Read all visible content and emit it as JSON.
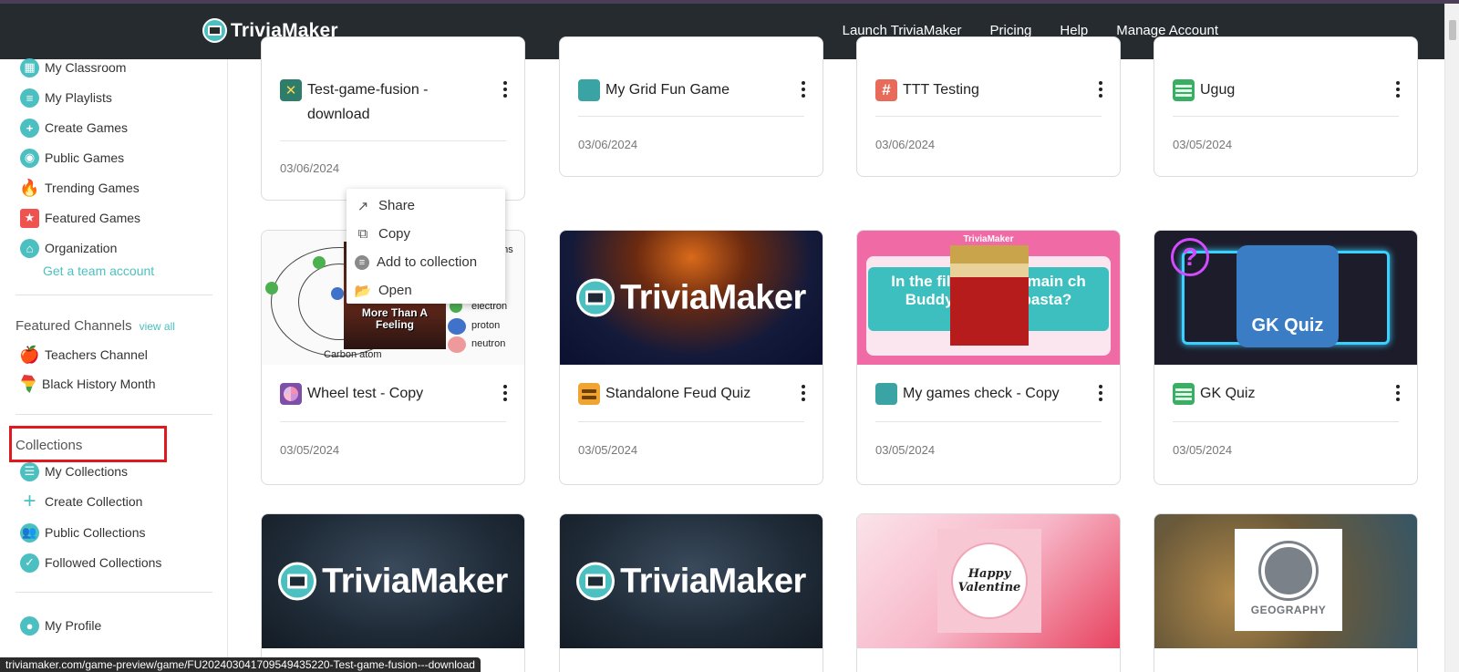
{
  "brand": {
    "name": "TriviaMaker"
  },
  "nav": {
    "links": [
      "Launch TriviaMaker",
      "Pricing",
      "Help",
      "Manage Account"
    ]
  },
  "sidebar": {
    "items": [
      {
        "label": "My Classroom",
        "icon": "classroom-icon"
      },
      {
        "label": "My Playlists",
        "icon": "playlist-icon"
      },
      {
        "label": "Create Games",
        "icon": "plus-icon"
      },
      {
        "label": "Public Games",
        "icon": "globe-icon"
      },
      {
        "label": "Trending Games",
        "icon": "flame-icon"
      },
      {
        "label": "Featured Games",
        "icon": "star-icon"
      },
      {
        "label": "Organization",
        "icon": "building-icon"
      }
    ],
    "team_link": "Get a team account",
    "featured_heading": "Featured Channels",
    "view_all": "view all",
    "channels": [
      {
        "label": "Teachers Channel",
        "icon": "apple-icon"
      },
      {
        "label": "Black History Month",
        "icon": "africa-icon"
      }
    ],
    "collections_heading": "Collections",
    "collections": [
      {
        "label": "My Collections",
        "icon": "list-icon"
      },
      {
        "label": "Create Collection",
        "icon": "plus-icon"
      },
      {
        "label": "Public Collections",
        "icon": "people-icon"
      },
      {
        "label": "Followed Collections",
        "icon": "check-icon"
      }
    ],
    "profile": {
      "label": "My Profile",
      "icon": "user-icon"
    }
  },
  "cards": {
    "row1": [
      {
        "title": "Test-game-fusion - download",
        "date": "03/06/2024",
        "icon": "fusion-icon"
      },
      {
        "title": "My Grid Fun Game",
        "date": "03/06/2024",
        "icon": "grid-icon"
      },
      {
        "title": "TTT Testing",
        "date": "03/06/2024",
        "icon": "hash-icon"
      },
      {
        "title": "Ugug",
        "date": "03/05/2024",
        "icon": "table-icon"
      }
    ],
    "row2": [
      {
        "title": "Wheel test - Copy",
        "date": "03/05/2024",
        "icon": "wheel-icon"
      },
      {
        "title": "Standalone Feud Quiz",
        "date": "03/05/2024",
        "icon": "feud-icon"
      },
      {
        "title": "My games check - Copy",
        "date": "03/05/2024",
        "icon": "grid-icon"
      },
      {
        "title": "GK Quiz",
        "date": "03/05/2024",
        "icon": "table-icon"
      }
    ]
  },
  "thumbs": {
    "atom": {
      "caption": "Carbon atom",
      "labels": [
        "ons",
        "electron",
        "proton",
        "neutron"
      ],
      "photo_text": "More Than A Feeling"
    },
    "brand_word": "TriviaMaker",
    "pink": {
      "header": "TriviaMaker",
      "question": "In the fil   hat is the main ch    Buddy's favorit     pasta?"
    },
    "gk": {
      "text": "GK Quiz",
      "mark": "?"
    },
    "valentine": {
      "text": "Happy Valentine"
    },
    "geo": {
      "text": "GEOGRAPHY"
    }
  },
  "context_menu": {
    "items": [
      {
        "label": "Share",
        "icon": "share-icon"
      },
      {
        "label": "Copy",
        "icon": "copy-icon"
      },
      {
        "label": "Add to collection",
        "icon": "add-circle-icon"
      },
      {
        "label": "Open",
        "icon": "folder-open-icon"
      }
    ]
  },
  "status_bar": {
    "url": "triviamaker.com/game-preview/game/FU20240304170954943522​0-Test-game-fusion---download"
  },
  "colors": {
    "accent": "#4cc0c0",
    "navbar": "#262b2f",
    "highlight": "#e0191f"
  }
}
